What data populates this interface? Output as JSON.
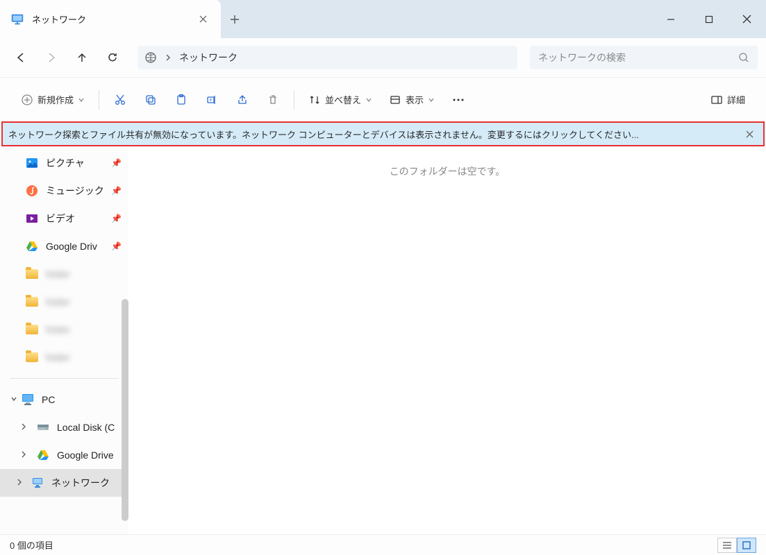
{
  "tab": {
    "title": "ネットワーク"
  },
  "breadcrumb": {
    "path": "ネットワーク"
  },
  "search": {
    "placeholder": "ネットワークの検索"
  },
  "toolbar": {
    "new": "新規作成",
    "sort": "並べ替え",
    "view": "表示",
    "details": "詳細"
  },
  "banner": {
    "message": "ネットワーク探索とファイル共有が無効になっています。ネットワーク コンピューターとデバイスは表示されません。変更するにはクリックしてください..."
  },
  "sidebar": {
    "pictures": "ピクチャ",
    "music": "ミュージック",
    "videos": "ビデオ",
    "gdrive": "Google Driv",
    "pc": "PC",
    "local_disk": "Local Disk (C",
    "gdrive2": "Google Drive",
    "network": "ネットワーク",
    "blur1": "folder",
    "blur2": "folder",
    "blur3": "folder",
    "blur4": "folder"
  },
  "content": {
    "empty": "このフォルダーは空です。"
  },
  "status": {
    "count": "0 個の項目"
  }
}
